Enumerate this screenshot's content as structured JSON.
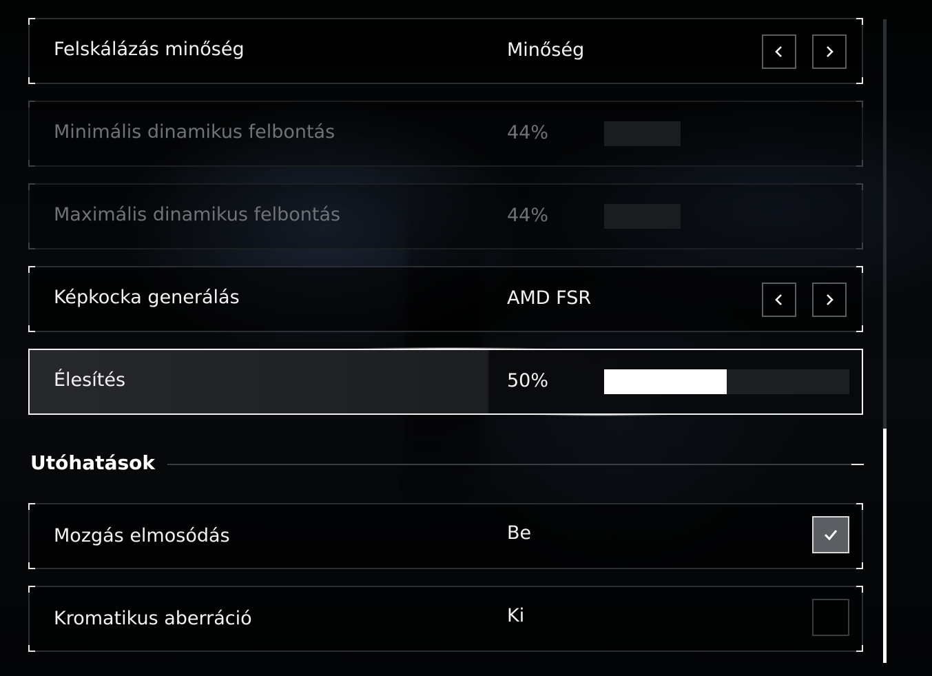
{
  "settings": [
    {
      "label": "Felskálázás minőség",
      "value": "Minőség",
      "control": "selector",
      "enabled": true
    },
    {
      "label": "Minimális dinamikus felbontás",
      "value": "44%",
      "control": "slider",
      "level": 0.44,
      "enabled": false
    },
    {
      "label": "Maximális dinamikus felbontás",
      "value": "44%",
      "control": "slider",
      "level": 0.44,
      "enabled": false
    },
    {
      "label": "Képkocka generálás",
      "value": "AMD FSR",
      "control": "selector",
      "enabled": true
    },
    {
      "label": "Élesítés",
      "value": "50%",
      "control": "slider",
      "level": 0.5,
      "enabled": true,
      "focused": true
    }
  ],
  "post_effects": {
    "title": "Utóhatások",
    "items": [
      {
        "label": "Mozgás elmosódás",
        "value": "Be",
        "control": "checkbox",
        "checked": true
      },
      {
        "label": "Kromatikus aberráció",
        "value": "Ki",
        "control": "checkbox",
        "checked": false
      }
    ]
  },
  "icons": {
    "prev": "chevron-left-icon",
    "next": "chevron-right-icon",
    "check": "checkmark-icon",
    "collapse": "minus-icon"
  },
  "colors": {
    "accent": "#ffffff",
    "disabled_text": "#6f7276",
    "border": "#2a2d31",
    "checkbox_on": "#5b5e62"
  },
  "scroll": {
    "position": 0.64
  }
}
